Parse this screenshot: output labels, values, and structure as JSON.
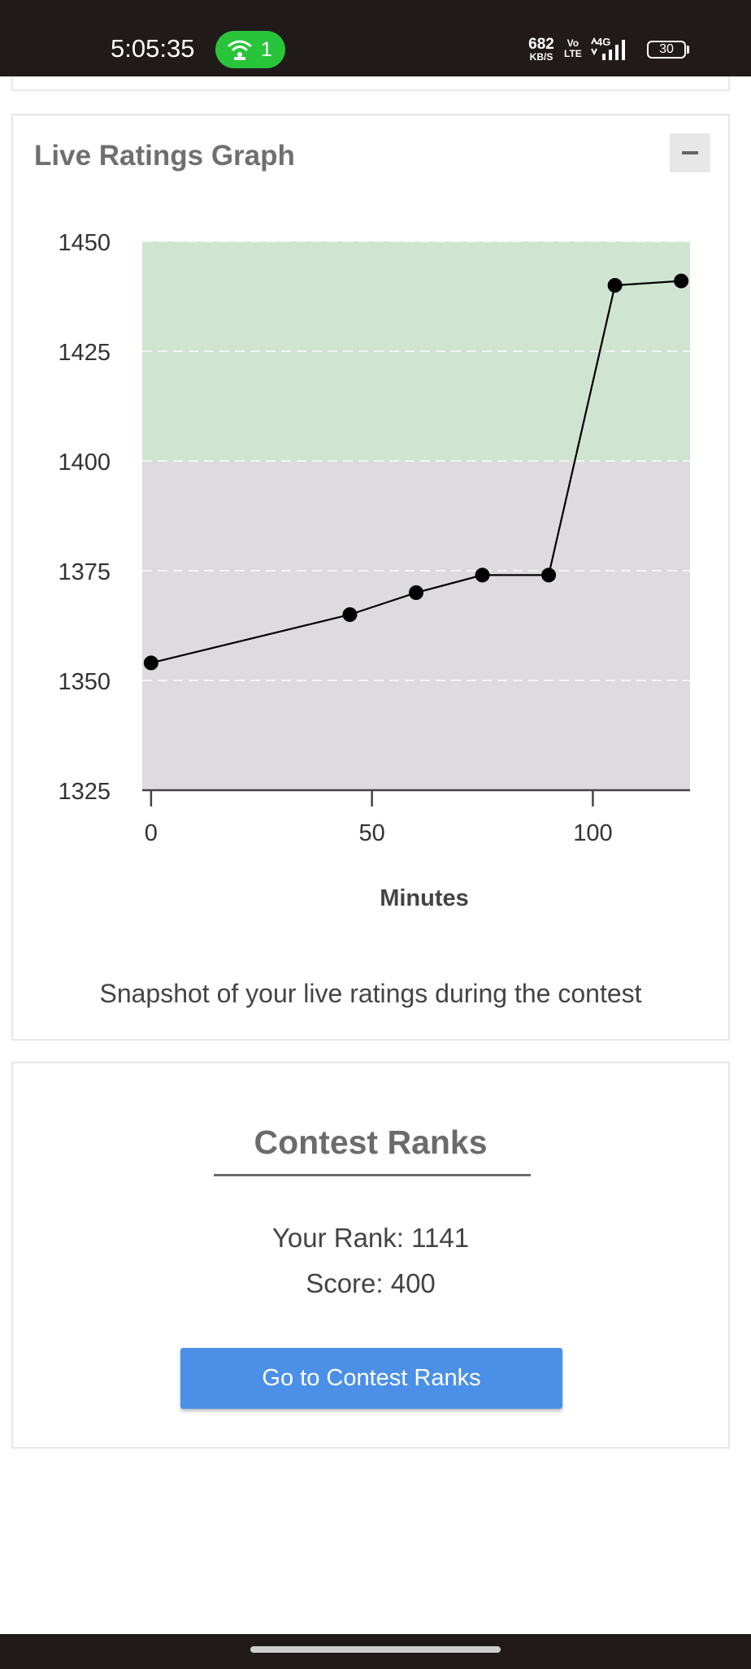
{
  "status_bar": {
    "time": "5:05:35",
    "hotspot_count": "1",
    "net_speed_value": "682",
    "net_speed_unit": "KB/S",
    "volte_top": "Vo",
    "volte_bottom": "LTE",
    "network": "4G",
    "battery": "30"
  },
  "graph_card": {
    "title": "Live Ratings Graph",
    "caption": "Snapshot of your live ratings during the contest"
  },
  "chart_data": {
    "type": "line",
    "xlabel": "Minutes",
    "ylabel": "",
    "xlim": [
      -2,
      122
    ],
    "ylim": [
      1325,
      1450
    ],
    "x_ticks": [
      0,
      50,
      100
    ],
    "y_ticks": [
      1325,
      1350,
      1375,
      1400,
      1425,
      1450
    ],
    "bands": [
      {
        "from": 1325,
        "to": 1400,
        "color": "#dddbdd"
      },
      {
        "from": 1400,
        "to": 1450,
        "color": "#cfe4d1"
      }
    ],
    "series": [
      {
        "x": [
          0,
          45,
          60,
          75,
          90,
          105,
          120
        ],
        "y": [
          1354,
          1365,
          1370,
          1374,
          1374,
          1440,
          1441
        ]
      }
    ],
    "grid": true
  },
  "ranks_card": {
    "title": "Contest Ranks",
    "rank_text": "Your Rank: 1141",
    "score_text": "Score: 400",
    "button_label": "Go to Contest Ranks"
  }
}
